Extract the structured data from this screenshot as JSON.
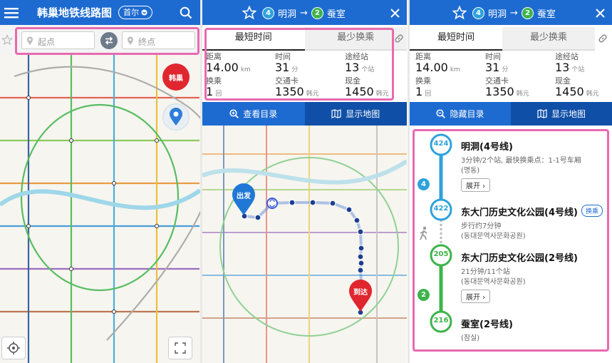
{
  "panel1": {
    "title": "韩巢地铁线路图",
    "city": "首尔",
    "start_placeholder": "起点",
    "end_placeholder": "终点",
    "badge_text": "韩巢",
    "icons": [
      "menu-icon",
      "search-icon",
      "star-icon",
      "location-pin-icon",
      "swap-icon",
      "locate-icon",
      "fullscreen-icon"
    ]
  },
  "route": {
    "from_line": "4",
    "from_station": "明洞",
    "to_line": "2",
    "to_station": "蚕室",
    "arrow": "→"
  },
  "tabs": {
    "shortest": "最短时间",
    "least_transfer": "最少换乘"
  },
  "stats": {
    "distance_label": "距离",
    "distance_value": "14.00",
    "distance_unit": "km",
    "time_label": "时间",
    "time_value": "31",
    "time_unit": "分",
    "stops_label": "途经站",
    "stops_value": "13",
    "stops_unit": "个站",
    "transfer_label": "换乘",
    "transfer_value": "1",
    "transfer_unit": "回",
    "card_label": "交通卡",
    "card_value": "1350",
    "card_unit": "韩元",
    "cash_label": "现金",
    "cash_value": "1450",
    "cash_unit": "韩元"
  },
  "panel2": {
    "list_button": "查看目录",
    "map_button": "显示地图",
    "start_marker": "出发",
    "end_marker": "到达"
  },
  "panel3": {
    "hide_button": "隐藏目录",
    "map_button": "显示地图",
    "stations": [
      {
        "code": "424",
        "name": "明洞(4号线)",
        "sub1": "3分钟/2个站, 最快换乘点：1-1号车厢",
        "sub2": "(명동)",
        "expand": "展开"
      },
      {
        "code": "422",
        "name": "东大门历史文化公园(4号线)",
        "transfer_badge": "换乘",
        "sub1": "步行约7分钟",
        "sub2": "(동대문역사문화공원)"
      },
      {
        "code": "205",
        "name": "东大门历史文化公园(2号线)",
        "sub1": "21分钟/11个站",
        "sub2": "(동대문역사문화공원)",
        "expand": "展开"
      },
      {
        "code": "216",
        "name": "蚕室(2号线)",
        "sub2": "(잠실)"
      }
    ],
    "line4_badge": "4",
    "line2_badge": "2"
  },
  "colors": {
    "header_blue": "#1d6bd1",
    "line4": "#2ea2db",
    "line2": "#3cb44a",
    "highlight": "#e86ab0",
    "dark_blue": "#0f4fa8"
  }
}
